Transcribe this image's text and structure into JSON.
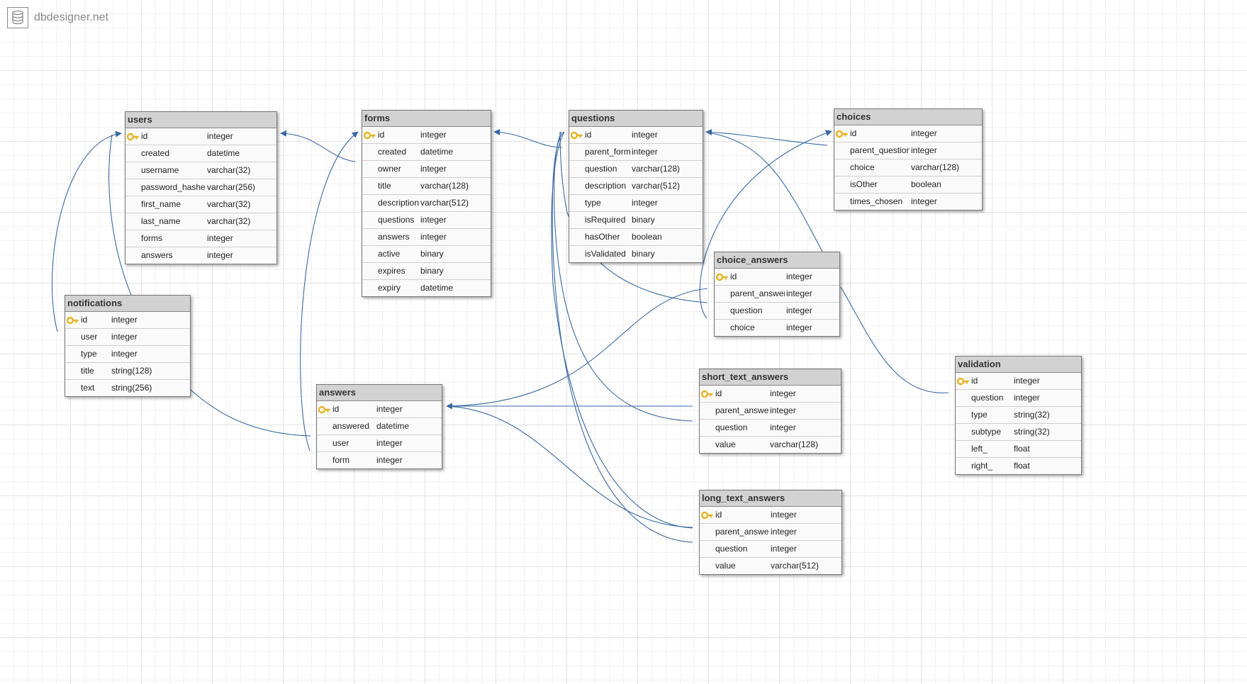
{
  "brand": {
    "name": "dbdesigner.net",
    "icon": "database-icon"
  },
  "colors": {
    "connector": "#3a6aa3",
    "header": "#d2d2d2",
    "key": "#e8b422"
  },
  "tables": [
    {
      "id": "users",
      "name": "users",
      "fields": [
        {
          "name": "id",
          "type": "integer",
          "pk": true
        },
        {
          "name": "created",
          "type": "datetime"
        },
        {
          "name": "username",
          "type": "varchar(32)"
        },
        {
          "name": "password_hashed",
          "type": "varchar(256)"
        },
        {
          "name": "first_name",
          "type": "varchar(32)"
        },
        {
          "name": "last_name",
          "type": "varchar(32)"
        },
        {
          "name": "forms",
          "type": "integer"
        },
        {
          "name": "answers",
          "type": "integer"
        }
      ]
    },
    {
      "id": "forms",
      "name": "forms",
      "fields": [
        {
          "name": "id",
          "type": "integer",
          "pk": true
        },
        {
          "name": "created",
          "type": "datetime"
        },
        {
          "name": "owner",
          "type": "integer"
        },
        {
          "name": "title",
          "type": "varchar(128)"
        },
        {
          "name": "description",
          "type": "varchar(512)"
        },
        {
          "name": "questions",
          "type": "integer"
        },
        {
          "name": "answers",
          "type": "integer"
        },
        {
          "name": "active",
          "type": "binary"
        },
        {
          "name": "expires",
          "type": "binary"
        },
        {
          "name": "expiry",
          "type": "datetime"
        }
      ]
    },
    {
      "id": "questions",
      "name": "questions",
      "fields": [
        {
          "name": "id",
          "type": "integer",
          "pk": true
        },
        {
          "name": "parent_form",
          "type": "integer"
        },
        {
          "name": "question",
          "type": "varchar(128)"
        },
        {
          "name": "description",
          "type": "varchar(512)"
        },
        {
          "name": "type",
          "type": "integer"
        },
        {
          "name": "isRequired",
          "type": "binary"
        },
        {
          "name": "hasOther",
          "type": "boolean"
        },
        {
          "name": "isValidated",
          "type": "binary"
        }
      ]
    },
    {
      "id": "choices",
      "name": "choices",
      "fields": [
        {
          "name": "id",
          "type": "integer",
          "pk": true
        },
        {
          "name": "parent_question",
          "type": "integer"
        },
        {
          "name": "choice",
          "type": "varchar(128)"
        },
        {
          "name": "isOther",
          "type": "boolean"
        },
        {
          "name": "times_chosen",
          "type": "integer"
        }
      ]
    },
    {
      "id": "notifications",
      "name": "notifications",
      "fields": [
        {
          "name": "id",
          "type": "integer",
          "pk": true
        },
        {
          "name": "user",
          "type": "integer"
        },
        {
          "name": "type",
          "type": "integer"
        },
        {
          "name": "title",
          "type": "string(128)"
        },
        {
          "name": "text",
          "type": "string(256)"
        }
      ]
    },
    {
      "id": "choice_answers",
      "name": "choice_answers",
      "fields": [
        {
          "name": "id",
          "type": "integer",
          "pk": true
        },
        {
          "name": "parent_answer",
          "type": "integer"
        },
        {
          "name": "question",
          "type": "integer"
        },
        {
          "name": "choice",
          "type": "integer"
        }
      ]
    },
    {
      "id": "answers",
      "name": "answers",
      "fields": [
        {
          "name": "id",
          "type": "integer",
          "pk": true
        },
        {
          "name": "answered",
          "type": "datetime"
        },
        {
          "name": "user",
          "type": "integer"
        },
        {
          "name": "form",
          "type": "integer"
        }
      ]
    },
    {
      "id": "short_text_answers",
      "name": "short_text_answers",
      "fields": [
        {
          "name": "id",
          "type": "integer",
          "pk": true
        },
        {
          "name": "parent_answer",
          "type": "integer"
        },
        {
          "name": "question",
          "type": "integer"
        },
        {
          "name": "value",
          "type": "varchar(128)"
        }
      ]
    },
    {
      "id": "validation",
      "name": "validation",
      "fields": [
        {
          "name": "id",
          "type": "integer",
          "pk": true
        },
        {
          "name": "question",
          "type": "integer"
        },
        {
          "name": "type",
          "type": "string(32)"
        },
        {
          "name": "subtype",
          "type": "string(32)"
        },
        {
          "name": "left_",
          "type": "float"
        },
        {
          "name": "right_",
          "type": "float"
        }
      ]
    },
    {
      "id": "long_text_answers",
      "name": "long_text_answers",
      "fields": [
        {
          "name": "id",
          "type": "integer",
          "pk": true
        },
        {
          "name": "parent_answer",
          "type": "integer"
        },
        {
          "name": "question",
          "type": "integer"
        },
        {
          "name": "value",
          "type": "varchar(512)"
        }
      ]
    }
  ]
}
